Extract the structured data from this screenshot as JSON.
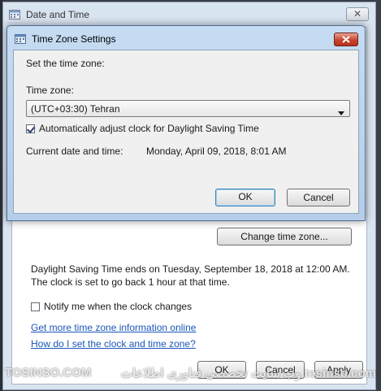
{
  "parent_window": {
    "title": "Date and Time",
    "close_glyph": "✕",
    "change_tz_label": "Change time zone...",
    "dst_line1": "Daylight Saving Time ends on Tuesday, September 18, 2018 at 12:00 AM.",
    "dst_line2": "The clock is set to go back 1 hour at that time.",
    "notify_label": "Notify me when the clock changes",
    "notify_checked": false,
    "link_more_info": "Get more time zone information online",
    "link_how_to": "How do I set the clock and time zone?",
    "ok_label": "OK",
    "cancel_label": "Cancel",
    "apply_label": "Apply"
  },
  "modal": {
    "title": "Time Zone Settings",
    "set_tz_text": "Set the time zone:",
    "tz_label": "Time zone:",
    "tz_selected": "(UTC+03:30) Tehran",
    "auto_dst_label": "Automatically adjust clock for Daylight Saving Time",
    "auto_dst_checked": true,
    "current_label": "Current date and time:",
    "current_value": "Monday, April 09, 2018, 8:01 AM",
    "ok_label": "OK",
    "cancel_label": "Cancel"
  },
  "watermark": {
    "left": "TOSINSO.COM",
    "right": "وب سایت تخصصی فناوری اطلاعات tosinso.com"
  },
  "colors": {
    "link": "#1a56b8",
    "close_red": "#c9452f",
    "title_blue": "#c6dcf2"
  }
}
